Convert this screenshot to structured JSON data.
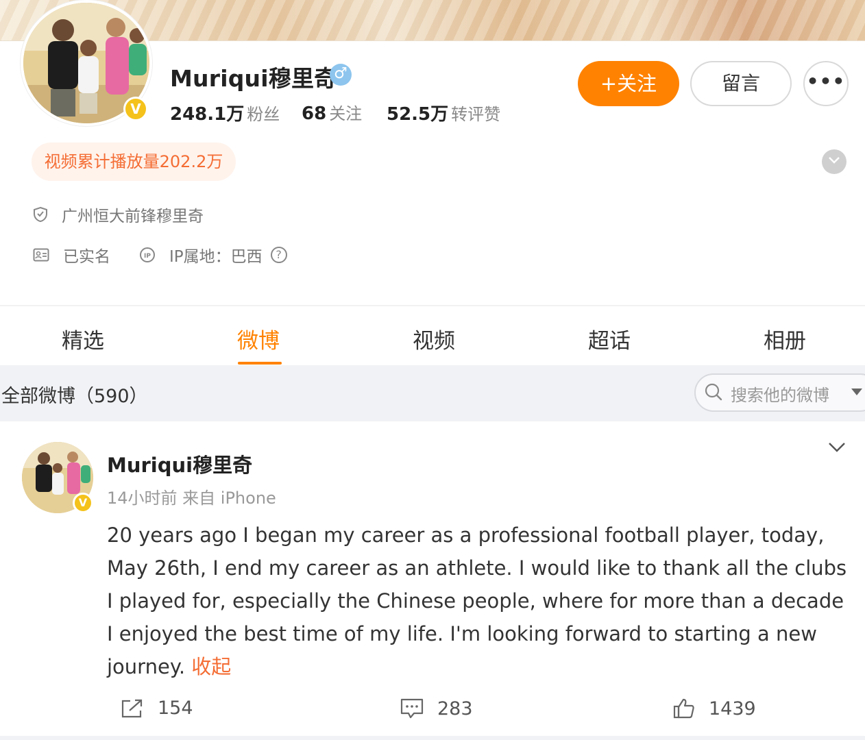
{
  "profile": {
    "name": "Muriqui穆里奇",
    "gender_symbol": "♂",
    "verified_symbol": "V",
    "stats": [
      {
        "num": "248.1万",
        "label": "粉丝"
      },
      {
        "num": "68",
        "label": "关注"
      },
      {
        "num": "52.5万",
        "label": "转评赞"
      }
    ],
    "follow_label": "+关注",
    "message_label": "留言",
    "more_label": "•••",
    "video_plays": "视频累计播放量202.2万",
    "verify_text": "广州恒大前锋穆里奇",
    "real_name": "已实名",
    "ip_location": "IP属地：巴西",
    "ip_help": "?"
  },
  "tabs": [
    {
      "label": "精选",
      "active": false
    },
    {
      "label": "微博",
      "active": true
    },
    {
      "label": "视频",
      "active": false
    },
    {
      "label": "超话",
      "active": false
    },
    {
      "label": "相册",
      "active": false
    }
  ],
  "filter": {
    "title": "全部微博（590）",
    "search_placeholder": "搜索他的微博"
  },
  "post": {
    "author": "Muriqui穆里奇",
    "meta": "14小时前  来自 iPhone",
    "text": "20 years ago I began my career as a professional football player, today, May 26th, I end my career as an athlete. I would like to thank all the clubs I played for, especially the Chinese people, where for more than a decade I enjoyed the best time of my life. I'm looking forward to starting a new journey. ",
    "fold_label": "收起",
    "reposts": "154",
    "comments": "283",
    "likes": "1439"
  },
  "colors": {
    "accent": "#ff8200",
    "link": "#f46d34",
    "verified": "#f4c21b",
    "gender": "#8dc5ee"
  },
  "icons": [
    "shield-icon",
    "id-card-icon",
    "ip-icon",
    "help-icon",
    "chevron-down-icon",
    "search-icon",
    "repost-icon",
    "comment-icon",
    "like-icon"
  ]
}
